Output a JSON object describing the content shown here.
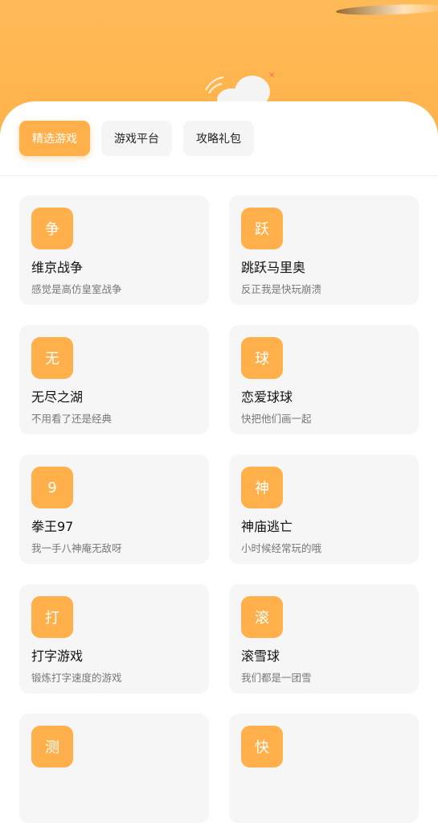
{
  "tabs": [
    {
      "label": "精选游戏",
      "active": true
    },
    {
      "label": "游戏平台",
      "active": false
    },
    {
      "label": "攻略礼包",
      "active": false
    }
  ],
  "games": [
    {
      "icon_char": "争",
      "title": "维京战争",
      "desc": "感觉是高仿皇室战争"
    },
    {
      "icon_char": "跃",
      "title": "跳跃马里奥",
      "desc": "反正我是快玩崩溃"
    },
    {
      "icon_char": "无",
      "title": "无尽之湖",
      "desc": "不用看了还是经典"
    },
    {
      "icon_char": "球",
      "title": "恋爱球球",
      "desc": "快把他们画一起"
    },
    {
      "icon_char": "9",
      "title": "拳王97",
      "desc": "我一手八神庵无敌呀"
    },
    {
      "icon_char": "神",
      "title": "神庙逃亡",
      "desc": "小时候经常玩的哦"
    },
    {
      "icon_char": "打",
      "title": "打字游戏",
      "desc": "锻炼打字速度的游戏"
    },
    {
      "icon_char": "滚",
      "title": "滚雪球",
      "desc": "我们都是一团雪"
    },
    {
      "icon_char": "测",
      "title": "",
      "desc": ""
    },
    {
      "icon_char": "快",
      "title": "",
      "desc": ""
    }
  ],
  "colors": {
    "accent": "#ffb04a",
    "card_bg": "#f6f6f6",
    "header_bg": "#ffba58"
  }
}
